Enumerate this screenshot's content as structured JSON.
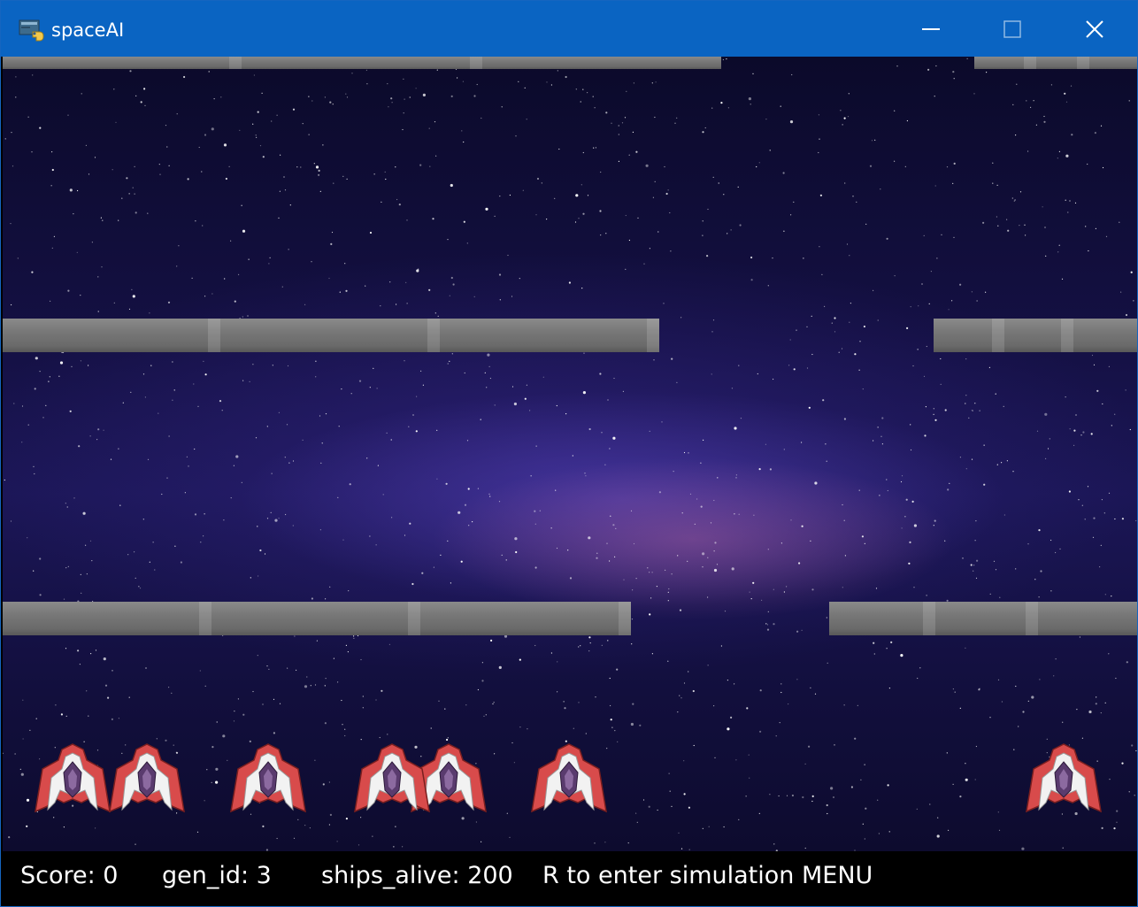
{
  "window": {
    "title": "spaceAI"
  },
  "hud": {
    "score": "Score: 0",
    "gen_id": "gen_id: 3",
    "ships_alive": "ships_alive: 200",
    "menu_hint": "R to enter simulation MENU"
  },
  "colors": {
    "titlebar": "#0a64c2",
    "pipe": "#777777",
    "ship_body": "#d84b4b",
    "ship_trim": "#f2f2f2",
    "ship_core": "#5a3b6e"
  },
  "icons": {
    "app": "python-icon",
    "minimize": "minimize-icon",
    "maximize": "maximize-icon",
    "close": "close-icon"
  }
}
